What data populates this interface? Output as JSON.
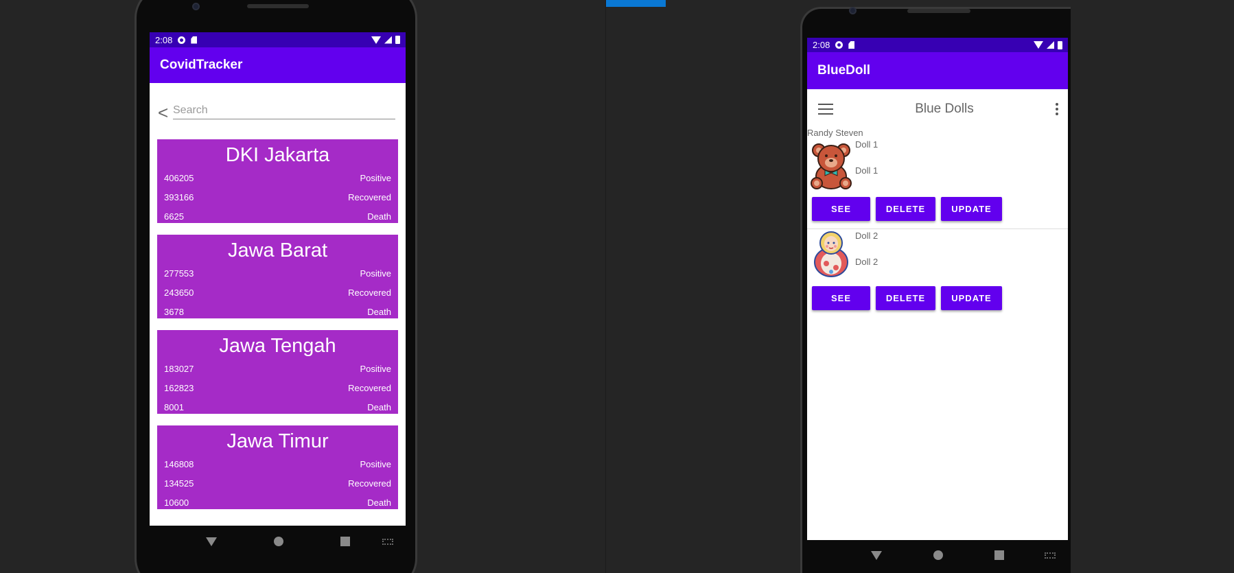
{
  "phone1": {
    "status": {
      "time": "2:08"
    },
    "app_title": "CovidTracker",
    "search": {
      "back_glyph": "<",
      "placeholder": "Search"
    },
    "cards": [
      {
        "province": "DKI Jakarta",
        "positive": "406205",
        "recovered": "393166",
        "death": "6625"
      },
      {
        "province": "Jawa Barat",
        "positive": "277553",
        "recovered": "243650",
        "death": "3678"
      },
      {
        "province": "Jawa Tengah",
        "positive": "183027",
        "recovered": "162823",
        "death": "8001"
      },
      {
        "province": "Jawa Timur",
        "positive": "146808",
        "recovered": "134525",
        "death": "10600"
      }
    ],
    "labels": {
      "positive": "Positive",
      "recovered": "Recovered",
      "death": "Death"
    },
    "colors": {
      "statusbar": "#3700b3",
      "appbar": "#6200ee",
      "card": "#a52bc7"
    }
  },
  "phone2": {
    "status": {
      "time": "2:08"
    },
    "app_title": "BlueDoll",
    "toolbar_title": "Blue Dolls",
    "owner": "Randy Steven",
    "dolls": [
      {
        "name": "Doll 1",
        "description": "Doll 1",
        "icon": "teddy-bear-icon"
      },
      {
        "name": "Doll 2",
        "description": "Doll 2",
        "icon": "matryoshka-doll-icon"
      }
    ],
    "buttons": {
      "see": "SEE",
      "delete": "DELETE",
      "update": "UPDATE"
    },
    "colors": {
      "statusbar": "#3700b3",
      "appbar": "#6200ee",
      "button": "#6200ee"
    }
  }
}
